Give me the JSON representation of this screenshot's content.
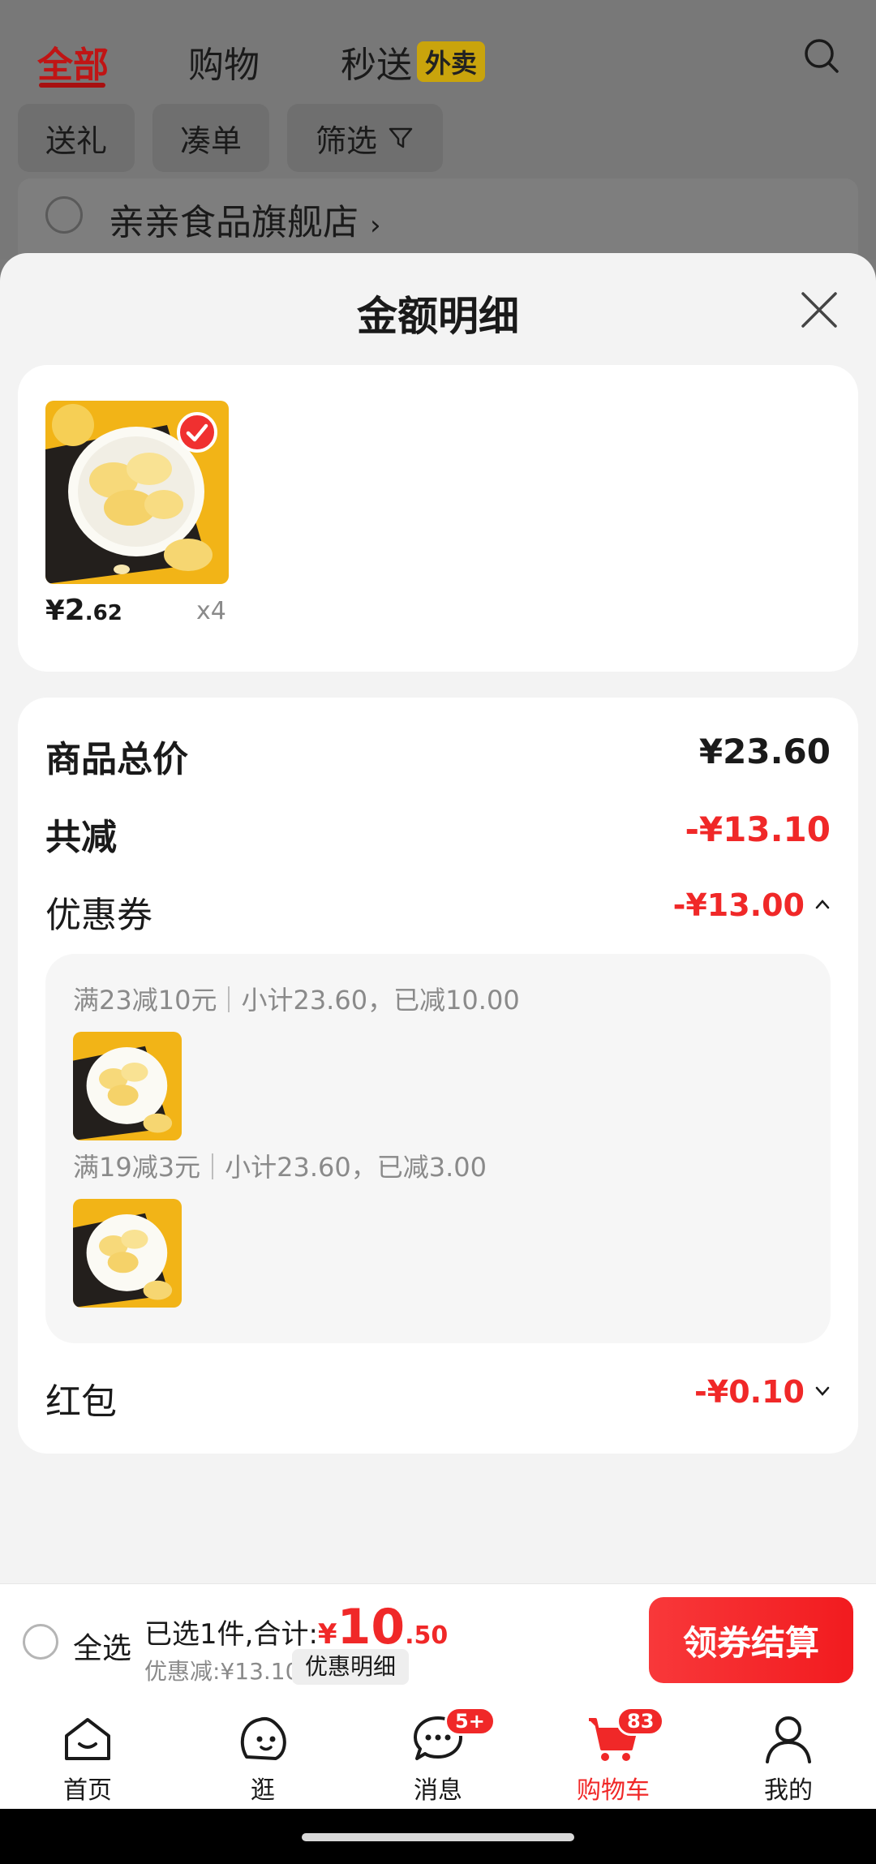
{
  "top_tabs": [
    {
      "label": "全部",
      "active": true
    },
    {
      "label": "购物",
      "active": false
    },
    {
      "label": "秒送",
      "active": false,
      "badge": "外卖"
    }
  ],
  "filter_chips": [
    "送礼",
    "凑单",
    "筛选"
  ],
  "store": {
    "name": "亲亲食品旗舰店",
    "chevron": "›"
  },
  "sheet": {
    "title": "金额明细",
    "product": {
      "currency": "¥",
      "price_int": "2",
      "price_dec": ".62",
      "quantity": "x4",
      "selected": true
    },
    "summary": {
      "total_label": "商品总价",
      "total_value": "¥23.60",
      "discount_label": "共减",
      "discount_value": "-¥13.10",
      "coupon_label": "优惠券",
      "coupon_value": "-¥13.00",
      "coupon_expanded": true,
      "coupons": [
        {
          "rule": "满23减10元",
          "detail": "小计23.60，已减10.00"
        },
        {
          "rule": "满19减3元",
          "detail": "小计23.60，已减3.00"
        }
      ],
      "redpacket_label": "红包",
      "redpacket_value": "-¥0.10"
    }
  },
  "checkout": {
    "select_all": "全选",
    "selected_text": "已选1件,合计:",
    "total_symbol": "¥",
    "total_int": "10",
    "total_dec": ".50",
    "saved_text": "优惠减:¥13.10",
    "detail_button": "优惠明细",
    "checkout_button": "领券结算"
  },
  "tabbar": {
    "items": [
      {
        "label": "首页",
        "icon": "home-icon"
      },
      {
        "label": "逛",
        "icon": "browse-icon"
      },
      {
        "label": "消息",
        "icon": "message-icon",
        "badge": "5+"
      },
      {
        "label": "购物车",
        "icon": "cart-icon",
        "badge": "83",
        "active": true
      },
      {
        "label": "我的",
        "icon": "profile-icon"
      }
    ]
  },
  "colors": {
    "accent_red": "#f02828",
    "title_tab_red": "#c01515",
    "badge_yellow": "#c9a40c"
  }
}
